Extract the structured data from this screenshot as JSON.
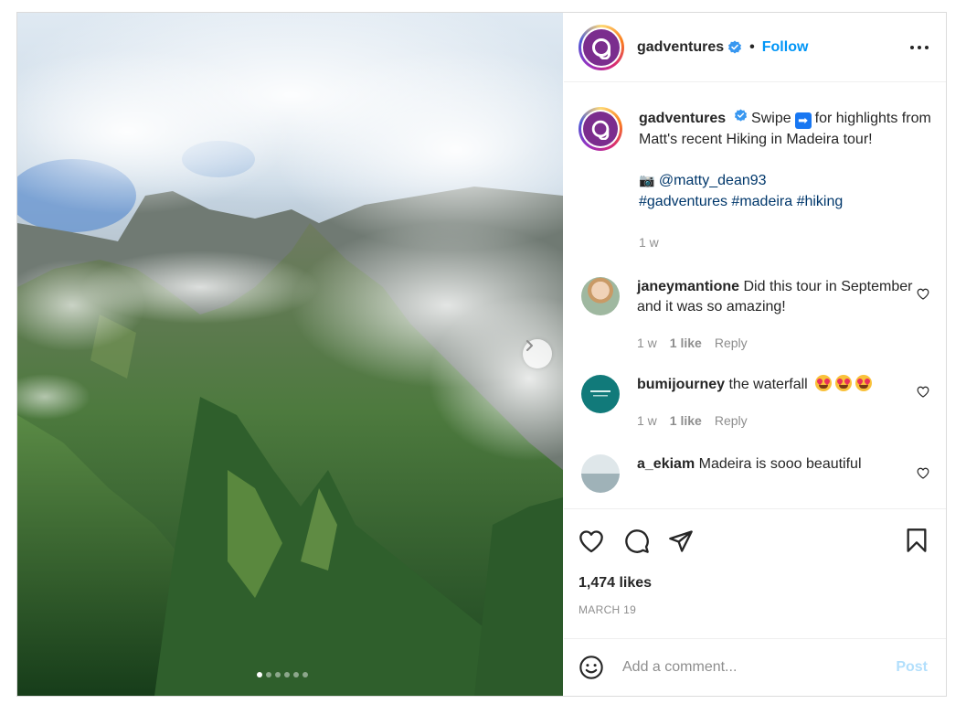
{
  "post": {
    "header": {
      "username": "gadventures",
      "separator": "•",
      "follow_label": "Follow"
    },
    "caption": {
      "username": "gadventures",
      "text_before_emoji": "Swipe",
      "emoji_arrow": "➡",
      "text_after_emoji": "for highlights from Matt's recent Hiking in Madeira tour!",
      "camera_emoji": "📷",
      "mention": "@matty_dean93",
      "hashtags": [
        "#gadventures",
        "#madeira",
        "#hiking"
      ],
      "age": "1 w"
    },
    "comments": [
      {
        "username": "janeymantione",
        "text": "Did this tour in September and it was so amazing!",
        "age": "1 w",
        "likes": "1 like",
        "reply_label": "Reply"
      },
      {
        "username": "bumijourney",
        "text": "the waterfall",
        "age": "1 w",
        "likes": "1 like",
        "reply_label": "Reply"
      },
      {
        "username": "a_ekiam",
        "text": "Madeira is sooo beautiful"
      }
    ],
    "likes_count": "1,474 likes",
    "date": "MARCH 19",
    "comment_input": {
      "placeholder": "Add a comment..."
    },
    "post_button_label": "Post",
    "carousel": {
      "total_slides": 6,
      "active_index": 0
    },
    "colors": {
      "accent": "#0095f6",
      "link": "#00376b",
      "post_disabled": "#b2dffc",
      "secondary_text": "#8e8e8e",
      "brand_purple": "#7b2d8e"
    }
  }
}
